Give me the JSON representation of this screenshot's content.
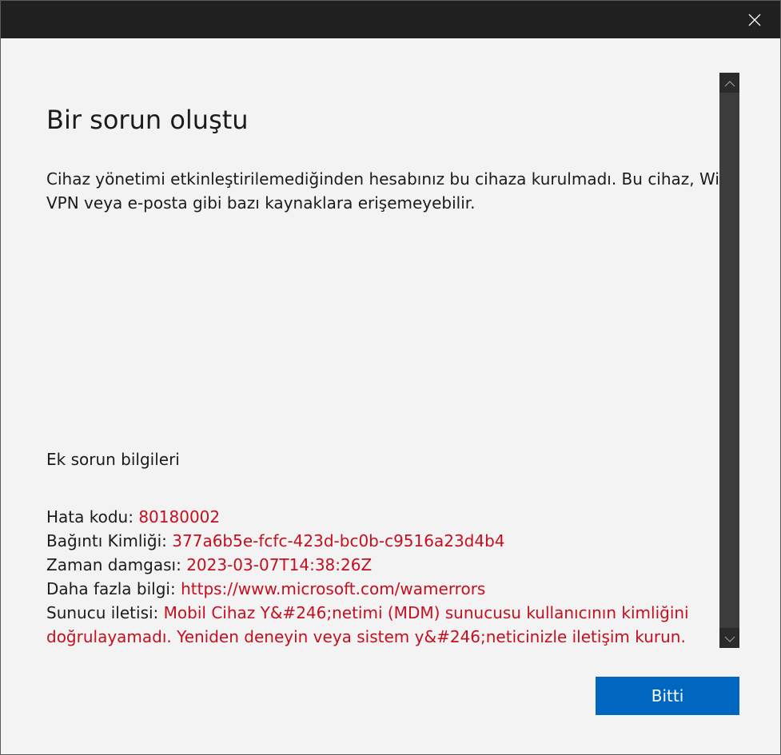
{
  "dialog": {
    "title": "Bir sorun oluştu",
    "description": "Cihaz yönetimi etkinleştirilemediğinden hesabınız bu cihaza kurulmadı. Bu cihaz, Wi-Fi, VPN veya e-posta gibi bazı kaynaklara erişemeyebilir.",
    "additional_title": "Ek sorun bilgileri",
    "details": {
      "error_code_label": "Hata kodu:",
      "error_code": "80180002",
      "correlation_id_label": "Bağıntı Kimliği:",
      "correlation_id": "377a6b5e-fcfc-423d-bc0b-c9516a23d4b4",
      "timestamp_label": "Zaman damgası:",
      "timestamp": "2023-03-07T14:38:26Z",
      "more_info_label": "Daha fazla bilgi:",
      "more_info_url": "https://www.microsoft.com/wamerrors",
      "server_message_label": "Sunucu iletisi:",
      "server_message": "Mobil Cihaz Y&#246;netimi (MDM) sunucusu kullanıcının kimliğini doğrulayamadı. Yeniden deneyin veya sistem y&#246;neticinizle iletişim kurun."
    },
    "done_label": "Bitti"
  },
  "icons": {
    "close": "close-icon",
    "scroll_up": "chevron-up-icon",
    "scroll_down": "chevron-down-icon"
  },
  "colors": {
    "titlebar": "#202020",
    "background": "#f3f3f3",
    "accent": "#0067c0",
    "error_value": "#c50f1f",
    "scrollbar": "#3c3c3c"
  }
}
